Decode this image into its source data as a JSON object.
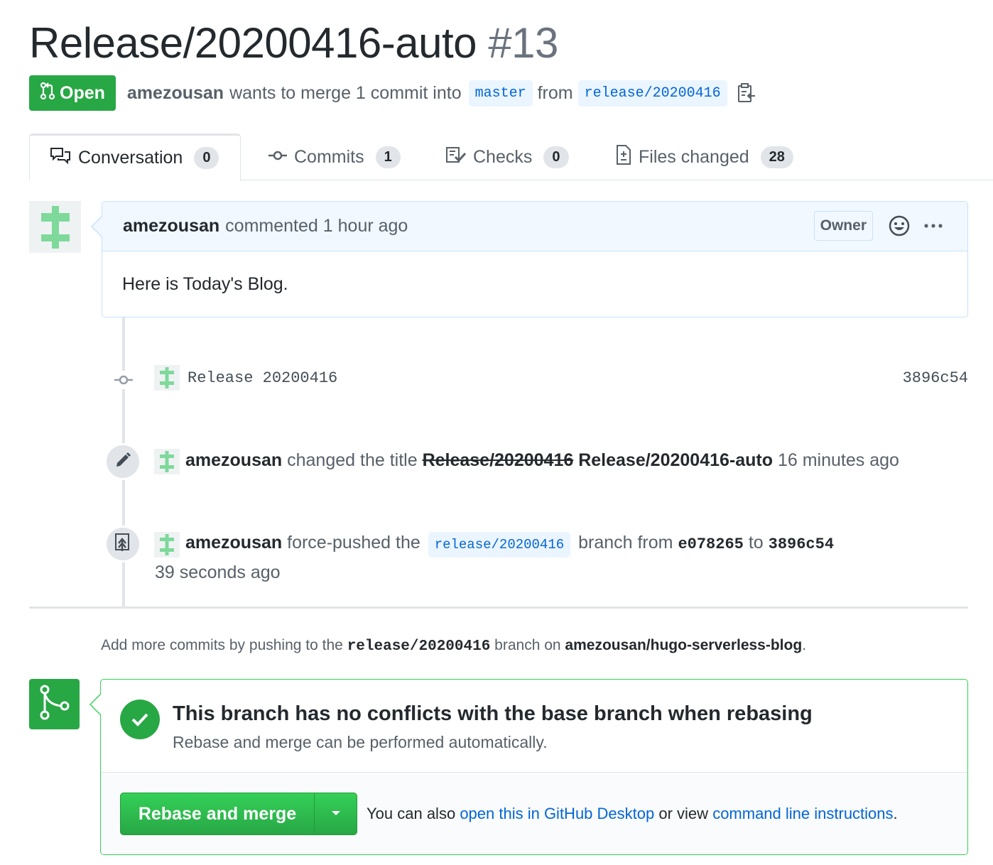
{
  "header": {
    "title": "Release/20200416-auto",
    "number": "#13",
    "state_label": "Open",
    "author": "amezousan",
    "merge_text_1": "wants to merge 1 commit into",
    "base_branch": "master",
    "merge_text_2": "from",
    "head_branch": "release/20200416"
  },
  "tabs": [
    {
      "label": "Conversation",
      "count": "0"
    },
    {
      "label": "Commits",
      "count": "1"
    },
    {
      "label": "Checks",
      "count": "0"
    },
    {
      "label": "Files changed",
      "count": "28"
    }
  ],
  "comment": {
    "author": "amezousan",
    "action": "commented",
    "time": "1 hour ago",
    "label": "Owner",
    "body": "Here is Today's Blog."
  },
  "timeline": {
    "commit": {
      "message": "Release 20200416",
      "sha": "3896c54"
    },
    "rename": {
      "author": "amezousan",
      "text": "changed the title",
      "old_title": "Release/20200416",
      "new_title": "Release/20200416-auto",
      "time": "16 minutes ago"
    },
    "force_push": {
      "author": "amezousan",
      "text_1": "force-pushed the",
      "branch": "release/20200416",
      "text_2": "branch from",
      "from_sha": "e078265",
      "text_3": "to",
      "to_sha": "3896c54",
      "time": "39 seconds ago"
    }
  },
  "hint": {
    "text_1": "Add more commits by pushing to the",
    "branch": "release/20200416",
    "text_2": "branch on",
    "repo": "amezousan/hugo-serverless-blog",
    "text_3": "."
  },
  "merge": {
    "heading": "This branch has no conflicts with the base branch when rebasing",
    "subtext": "Rebase and merge can be performed automatically.",
    "button_label": "Rebase and merge",
    "alt_text_1": "You can also",
    "alt_link_1": "open this in GitHub Desktop",
    "alt_text_2": "or view",
    "alt_link_2": "command line instructions",
    "alt_text_3": "."
  },
  "colors": {
    "green": "#28a745",
    "link": "#0366d6",
    "avatar_green": "#7ed99b"
  }
}
